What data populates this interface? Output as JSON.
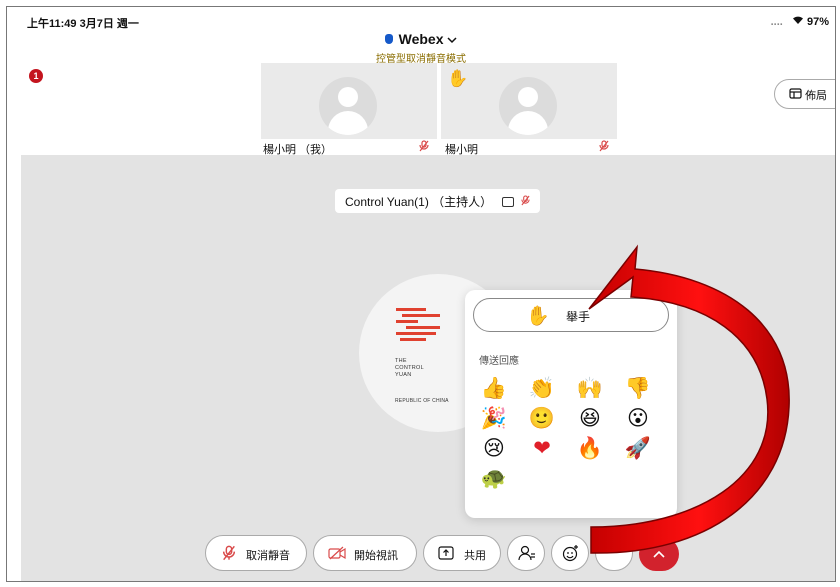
{
  "status_bar": {
    "time": "上午11:49  3月7日 週一",
    "indicators": "....",
    "battery": "97%"
  },
  "header": {
    "app_title": "Webex",
    "subtitle": "控管型取消靜音模式"
  },
  "notification": {
    "count": "1"
  },
  "participants": [
    {
      "name": "楊小明 （我）",
      "hand_raised": false,
      "muted": true
    },
    {
      "name": "楊小明",
      "hand_raised": true,
      "muted": true
    }
  ],
  "layout_button": {
    "label": "佈局"
  },
  "presenter": {
    "label": "Control Yuan(1) （主持人）"
  },
  "logo": {
    "line1": "THE",
    "line2": "CONTROL",
    "line3": "YUAN",
    "line4": "REPUBLIC OF CHINA",
    "color": "#e0412f"
  },
  "reactions": {
    "raise_hand_label": "舉手",
    "header": "傳送回應",
    "emojis": [
      {
        "name": "thumbs-up-icon",
        "glyph": "👍"
      },
      {
        "name": "clapping-icon",
        "glyph": "👏"
      },
      {
        "name": "celebrate-hands-icon",
        "glyph": "🙌"
      },
      {
        "name": "thumbs-down-icon",
        "glyph": "👎"
      },
      {
        "name": "party-popper-icon",
        "glyph": "🎉"
      },
      {
        "name": "smile-icon",
        "glyph": "🙂"
      },
      {
        "name": "laughing-icon",
        "glyph": "😆"
      },
      {
        "name": "surprised-icon",
        "glyph": "😮"
      },
      {
        "name": "sad-icon",
        "glyph": "😢"
      },
      {
        "name": "heart-icon",
        "glyph": "❤"
      },
      {
        "name": "fire-icon",
        "glyph": "🔥"
      },
      {
        "name": "speed-icon",
        "glyph": "🚀"
      },
      {
        "name": "turtle-icon",
        "glyph": "🐢"
      }
    ]
  },
  "toolbar": {
    "unmute_label": "取消靜音",
    "video_label": "開始視訊",
    "share_label": "共用"
  },
  "colors": {
    "accent_red": "#d2222d",
    "mute_red": "#d94a4a",
    "arrow_red": "#ff0000"
  }
}
